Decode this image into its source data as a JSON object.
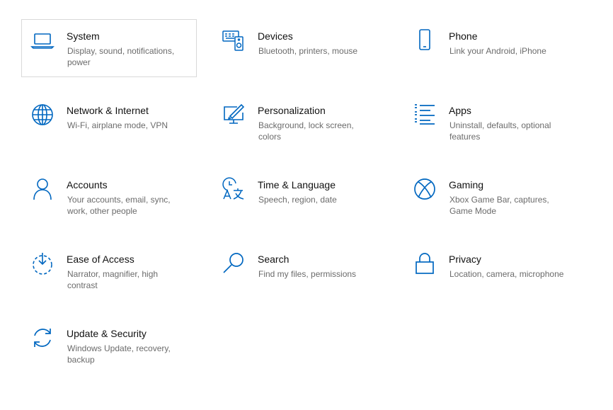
{
  "accent_color": "#0067c0",
  "tiles": [
    {
      "title": "System",
      "desc": "Display, sound, notifications, power",
      "icon": "laptop-icon"
    },
    {
      "title": "Devices",
      "desc": "Bluetooth, printers, mouse",
      "icon": "devices-icon"
    },
    {
      "title": "Phone",
      "desc": "Link your Android, iPhone",
      "icon": "phone-icon"
    },
    {
      "title": "Network & Internet",
      "desc": "Wi-Fi, airplane mode, VPN",
      "icon": "globe-icon"
    },
    {
      "title": "Personalization",
      "desc": "Background, lock screen, colors",
      "icon": "personalization-icon"
    },
    {
      "title": "Apps",
      "desc": "Uninstall, defaults, optional features",
      "icon": "apps-list-icon"
    },
    {
      "title": "Accounts",
      "desc": "Your accounts, email, sync, work, other people",
      "icon": "person-icon"
    },
    {
      "title": "Time & Language",
      "desc": "Speech, region, date",
      "icon": "time-language-icon"
    },
    {
      "title": "Gaming",
      "desc": "Xbox Game Bar, captures, Game Mode",
      "icon": "xbox-icon"
    },
    {
      "title": "Ease of Access",
      "desc": "Narrator, magnifier, high contrast",
      "icon": "ease-of-access-icon"
    },
    {
      "title": "Search",
      "desc": "Find my files, permissions",
      "icon": "search-icon"
    },
    {
      "title": "Privacy",
      "desc": "Location, camera, microphone",
      "icon": "lock-icon"
    },
    {
      "title": "Update & Security",
      "desc": "Windows Update, recovery, backup",
      "icon": "sync-icon"
    }
  ]
}
